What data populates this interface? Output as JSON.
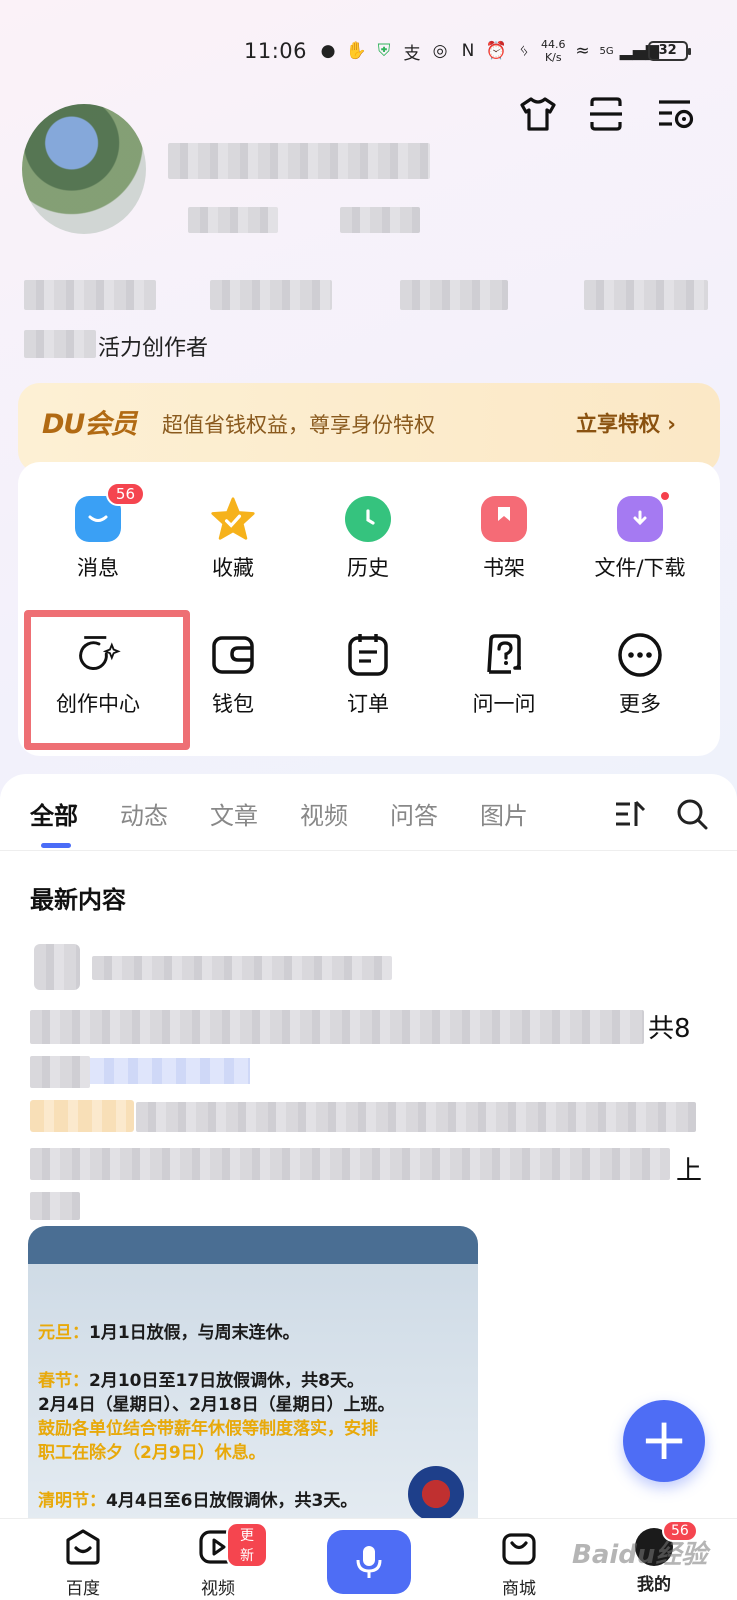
{
  "status_bar": {
    "time": "11:06",
    "net_speed_value": "44.6",
    "net_speed_unit": "K/s",
    "signal_label": "5G",
    "battery": "32"
  },
  "header_icons": [
    "shirt-icon",
    "scan-list-icon",
    "settings-list-icon"
  ],
  "profile": {
    "creator_level": "活力创作者"
  },
  "du_banner": {
    "logo": "DU会员",
    "text": "超值省钱权益，尊享身份特权",
    "cta": "立享特权 ›"
  },
  "grid": {
    "row1": [
      {
        "label": "消息",
        "icon": "message-icon",
        "color": "#3aa0f5",
        "badge": "56"
      },
      {
        "label": "收藏",
        "icon": "star-icon",
        "color": "#f6b21b"
      },
      {
        "label": "历史",
        "icon": "clock-icon",
        "color": "#35c37e"
      },
      {
        "label": "书架",
        "icon": "bookmark-icon",
        "color": "#f56b76"
      },
      {
        "label": "文件/下载",
        "icon": "download-folder-icon",
        "color": "#a57af2",
        "dot": true
      }
    ],
    "row2": [
      {
        "label": "创作中心",
        "icon": "create-center-icon"
      },
      {
        "label": "钱包",
        "icon": "wallet-icon"
      },
      {
        "label": "订单",
        "icon": "order-icon"
      },
      {
        "label": "问一问",
        "icon": "ask-icon"
      },
      {
        "label": "更多",
        "icon": "more-icon"
      }
    ]
  },
  "tabs": [
    "全部",
    "动态",
    "文章",
    "视频",
    "问答",
    "图片"
  ],
  "content": {
    "section_title": "最新内容",
    "partial_text_1": "共8",
    "partial_text_2": "上",
    "post_image_lines": [
      {
        "label": "元旦：",
        "text": "1月1日放假，与周末连休。"
      },
      {
        "label": "春节：",
        "text": "2月10日至17日放假调休，共8天。"
      },
      {
        "label": "",
        "text": "2月4日（星期日）、2月18日（星期日）上班。"
      },
      {
        "label": "",
        "text": "鼓励各单位结合带薪年休假等制度落实，安排"
      },
      {
        "label": "",
        "text": "职工在除夕（2月9日）休息。"
      },
      {
        "label": "清明节：",
        "text": "4月4日至6日放假调休，共3天。"
      }
    ]
  },
  "fab_label": "+",
  "bottom_nav": [
    {
      "label": "百度",
      "icon": "baidu-home-icon"
    },
    {
      "label": "视频",
      "icon": "video-icon",
      "badge": "更新"
    },
    {
      "label": "",
      "icon": "microphone-icon"
    },
    {
      "label": "商城",
      "icon": "shop-bag-icon"
    },
    {
      "label": "我的",
      "icon": "profile-icon",
      "badge": "56"
    }
  ],
  "watermark": "Baidu经验"
}
